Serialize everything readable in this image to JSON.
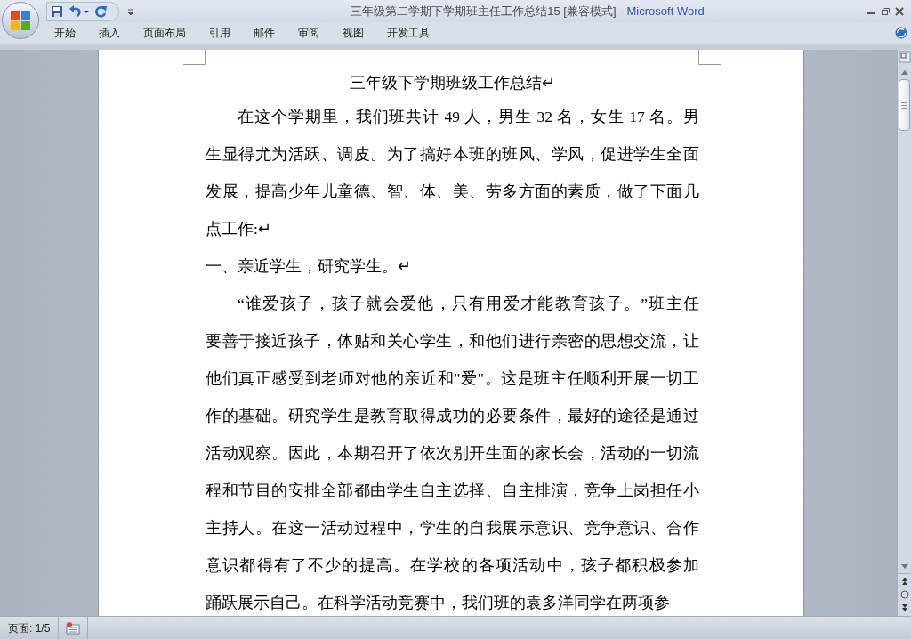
{
  "window": {
    "title": "三年级第二学期下学期班主任工作总结15 [兼容模式]",
    "app": "- Microsoft Word"
  },
  "quick_access": [
    {
      "kind": "save"
    },
    {
      "kind": "undo"
    },
    {
      "kind": "redo"
    }
  ],
  "tabs": [
    {
      "label": "开始",
      "selected": false
    },
    {
      "label": "插入",
      "selected": false
    },
    {
      "label": "页面布局",
      "selected": false
    },
    {
      "label": "引用",
      "selected": false
    },
    {
      "label": "邮件",
      "selected": false
    },
    {
      "label": "审阅",
      "selected": false
    },
    {
      "label": "视图",
      "selected": false
    },
    {
      "label": "开发工具",
      "selected": false
    }
  ],
  "document": {
    "title": "三年级下学期班级工作总结↵",
    "paragraphs": [
      {
        "kind": "body",
        "lines": [
          "在这个学期里，我们班共计 49 人，男生 32 名，女生 17 名。男",
          "生显得尤为活跃、调皮。为了搞好本班的班风、学风，促进学生全面",
          "发展，提高少年儿童德、智、体、美、劳多方面的素质，做了下面几",
          "点工作:↵"
        ]
      },
      {
        "kind": "heading",
        "lines": [
          "一、亲近学生，研究学生。↵"
        ]
      },
      {
        "kind": "body",
        "lines": [
          "“谁爱孩子，孩子就会爱他，只有用爱才能教育孩子。”班主任",
          "要善于接近孩子，体贴和关心学生，和他们进行亲密的思想交流，让",
          "他们真正感受到老师对他的亲近和\"爱\"。这是班主任顺利开展一切工",
          "作的基础。研究学生是教育取得成功的必要条件，最好的途径是通过",
          "活动观察。因此，本期召开了依次别开生面的家长会，活动的一切流",
          "程和节目的安排全部都由学生自主选择、自主排演，竞争上岗担任小",
          "主持人。在这一活动过程中，学生的自我展示意识、竞争意识、合作",
          "意识都得有了不少的提高。在学校的各项活动中，孩子都积极参加",
          "踊跃展示自己。在科学活动竞赛中，我们班的袁多洋同学在两项参"
        ]
      }
    ]
  },
  "status_bar": {
    "page": "页面: 1/5"
  }
}
